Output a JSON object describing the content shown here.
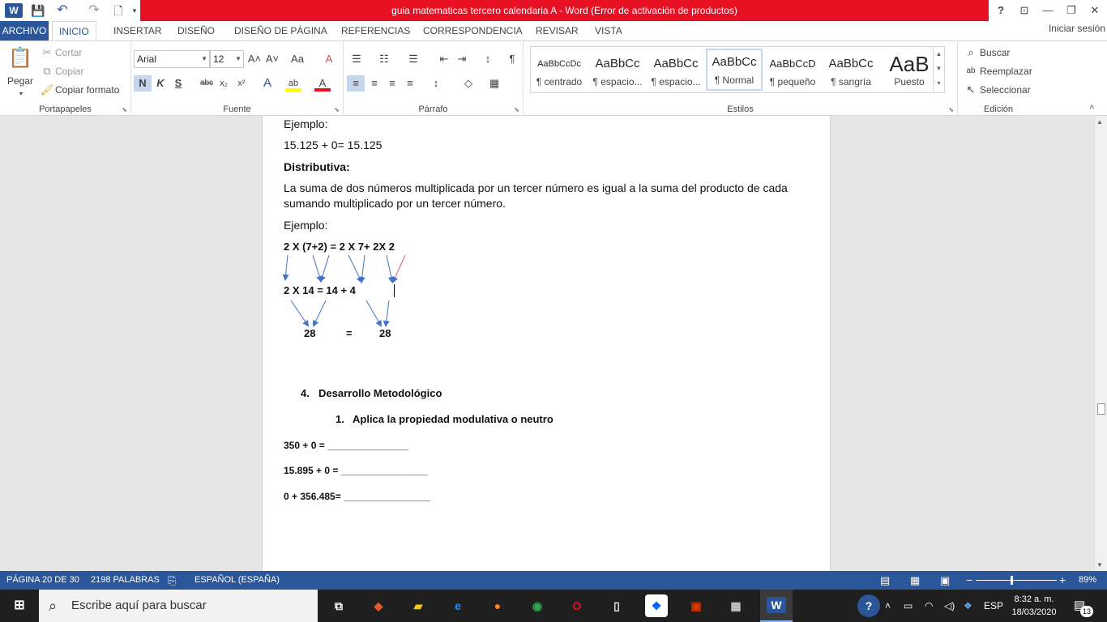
{
  "titlebar": {
    "title": "guia matematicas tercero calendaria A -  Word (Error de activación de productos)",
    "help": "?",
    "restore_ribbon": "⊡",
    "minimize": "—",
    "maximize": "❐",
    "close": "✕"
  },
  "qat": {
    "word": "W",
    "save": "💾",
    "undo": "↶",
    "redo": "↷",
    "new": "🗋",
    "customize": "▾"
  },
  "tabs": [
    "ARCHIVO",
    "INICIO",
    "INSERTAR",
    "DISEÑO",
    "DISEÑO DE PÁGINA",
    "REFERENCIAS",
    "CORRESPONDENCIA",
    "REVISAR",
    "VISTA"
  ],
  "signin": "Iniciar sesión",
  "ribbon": {
    "clipboard": {
      "label": "Portapapeles",
      "paste": "Pegar",
      "cut": "Cortar",
      "copy": "Copiar",
      "format_painter": "Copiar formato"
    },
    "font": {
      "label": "Fuente",
      "family": "Arial",
      "size": "12",
      "grow": "A˄",
      "shrink": "A˅",
      "case": "Aa",
      "clear": "A",
      "bold": "N",
      "italic": "K",
      "underline": "S",
      "strike": "abc",
      "sub": "x₂",
      "sup": "x²",
      "effects": "A",
      "highlight": "ab",
      "color": "A"
    },
    "paragraph": {
      "label": "Párrafo",
      "bullets": "☰",
      "numbering": "☷",
      "multilevel": "☰",
      "decrease_indent": "⇤",
      "increase_indent": "⇥",
      "sort": "↕",
      "show_marks": "¶",
      "align_left": "≡",
      "center": "≡",
      "align_right": "≡",
      "justify": "≡",
      "spacing": "↕",
      "shading": "◇",
      "borders": "▦"
    },
    "styles": {
      "label": "Estilos",
      "items": [
        {
          "preview": "AaBbCcDc",
          "name": "¶ centrado"
        },
        {
          "preview": "AaBbCc",
          "name": "¶ espacio..."
        },
        {
          "preview": "AaBbCc",
          "name": "¶ espacio..."
        },
        {
          "preview": "AaBbCc",
          "name": "¶ Normal"
        },
        {
          "preview": "AaBbCcD",
          "name": "¶ pequeño"
        },
        {
          "preview": "AaBbCc",
          "name": "¶ sangría"
        },
        {
          "preview": "AaB",
          "name": "Puesto"
        }
      ],
      "selected_index": 3
    },
    "editing": {
      "label": "Edición",
      "find": "Buscar",
      "replace": "Reemplazar",
      "select": "Seleccionar"
    }
  },
  "document": {
    "l1": "Ejemplo:",
    "l2": "15.125 + 0= 15.125",
    "l3": "Distributiva:",
    "l4a": "La suma de dos números multiplicada por un tercer número es igual a la suma del producto de cada",
    "l4b": "sumando multiplicado por un tercer número.",
    "l5": "Ejemplo:",
    "eq1": "2 X (7+2) = 2 X 7+  2X 2",
    "eq2": "2  X    14     =  14  + 4",
    "eq3a": "28",
    "eq3b": "=",
    "eq3c": "28",
    "section_num": "4.",
    "section_title": "Desarrollo Metodológico",
    "sub_num": "1.",
    "sub_title": "Aplica la propiedad modulativa o neutro",
    "ex1": "350 + 0 =  _______________",
    "ex2": "15.895  +  0  = ________________",
    "ex3": "0   +   356.485= ________________"
  },
  "status": {
    "page": "PÁGINA 20 DE 30",
    "words": "2198 PALABRAS",
    "language": "ESPAÑOL (ESPAÑA)",
    "zoom": "89%",
    "zoom_minus": "−",
    "zoom_plus": "+"
  },
  "taskbar": {
    "search_placeholder": "Escribe aquí para buscar",
    "lang": "ESP",
    "time": "8:32 a. m.",
    "date": "18/03/2020",
    "notifications": "13"
  },
  "colors": {
    "word_blue": "#2b579a",
    "error_red": "#e81123",
    "arrow_blue": "#4472c4",
    "arrow_pink": "#d06090"
  }
}
